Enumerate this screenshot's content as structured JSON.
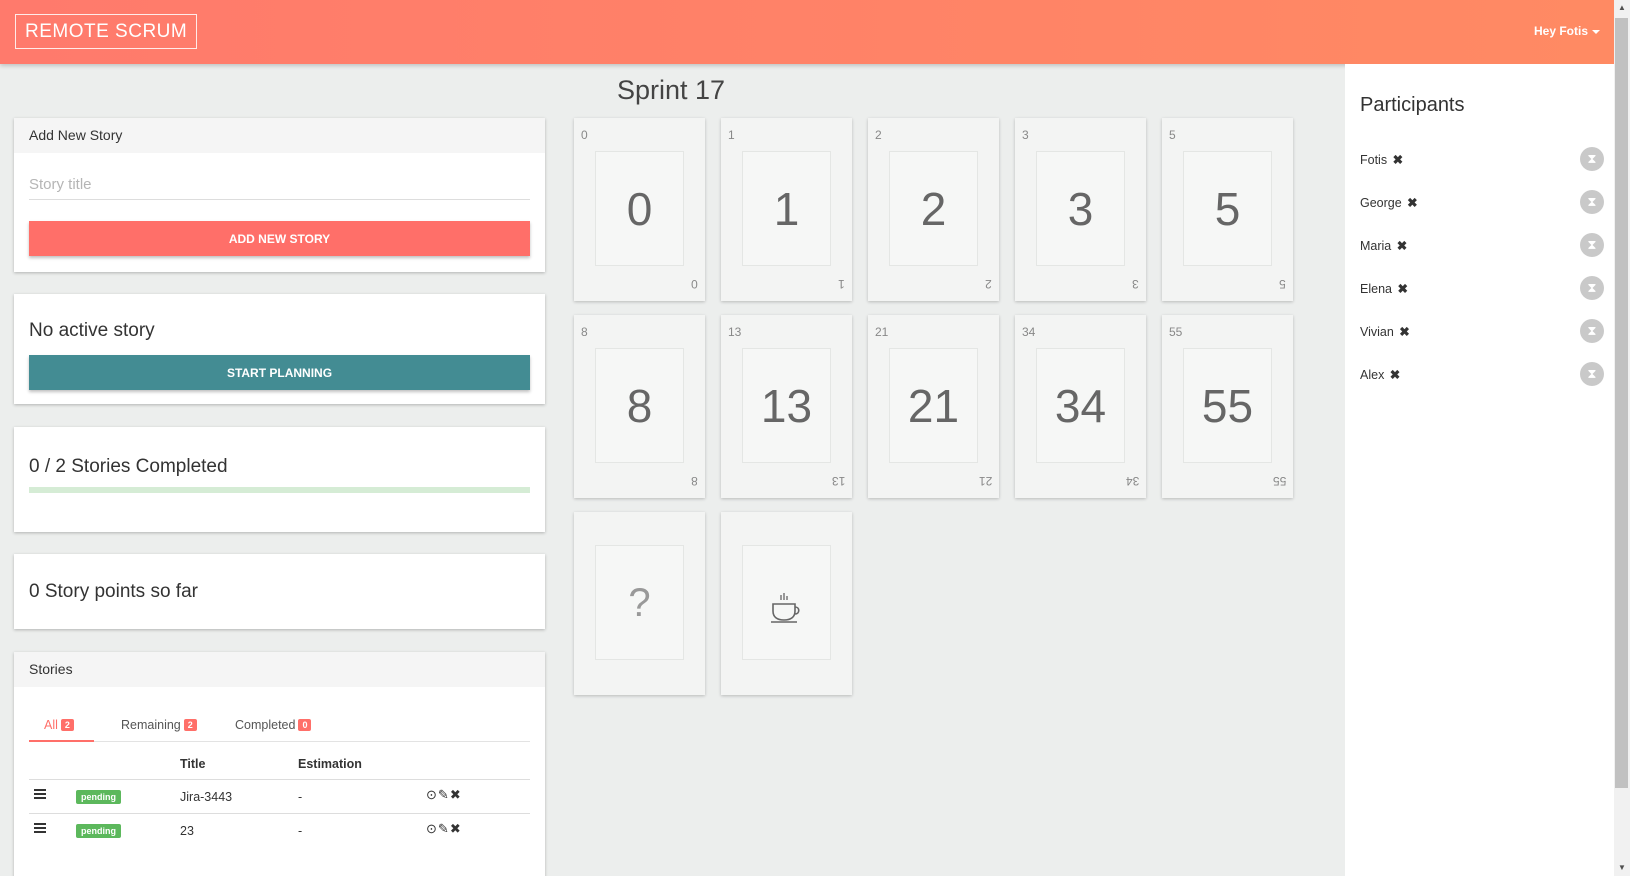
{
  "header": {
    "logo": "REMOTE SCRUM",
    "user_greeting": "Hey Fotis"
  },
  "add_story": {
    "heading": "Add New Story",
    "input_placeholder": "Story title",
    "button_label": "ADD NEW STORY"
  },
  "active_story": {
    "text": "No active story",
    "button_label": "START PLANNING"
  },
  "progress": {
    "text": "0 / 2 Stories Completed",
    "fraction": 0
  },
  "points": {
    "text": "0 Story points so far"
  },
  "stories": {
    "heading": "Stories",
    "tabs": [
      {
        "label": "All",
        "count": "2"
      },
      {
        "label": "Remaining",
        "count": "2"
      },
      {
        "label": "Completed",
        "count": "0"
      }
    ],
    "columns": [
      "Title",
      "Estimation"
    ],
    "rows": [
      {
        "status": "pending",
        "title": "Jira-3443",
        "estimation": "-"
      },
      {
        "status": "pending",
        "title": "23",
        "estimation": "-"
      }
    ]
  },
  "sprint_title": "Sprint 17",
  "cards": [
    {
      "value": "0",
      "icon": ""
    },
    {
      "value": "1",
      "icon": ""
    },
    {
      "value": "2",
      "icon": ""
    },
    {
      "value": "3",
      "icon": ""
    },
    {
      "value": "5",
      "icon": ""
    },
    {
      "value": "8",
      "icon": ""
    },
    {
      "value": "13",
      "icon": ""
    },
    {
      "value": "21",
      "icon": ""
    },
    {
      "value": "34",
      "icon": ""
    },
    {
      "value": "55",
      "icon": ""
    },
    {
      "value": "?",
      "icon": ""
    },
    {
      "value": "",
      "icon": "coffee-cup-icon"
    }
  ],
  "participants": {
    "title": "Participants",
    "list": [
      "Fotis",
      "George",
      "Maria",
      "Elena",
      "Vivian",
      "Alex"
    ]
  },
  "colors": {
    "header": "#ff7a6c",
    "accent": "#ff6f69",
    "start_button": "#438c93",
    "pending_badge": "#5cb85c"
  }
}
